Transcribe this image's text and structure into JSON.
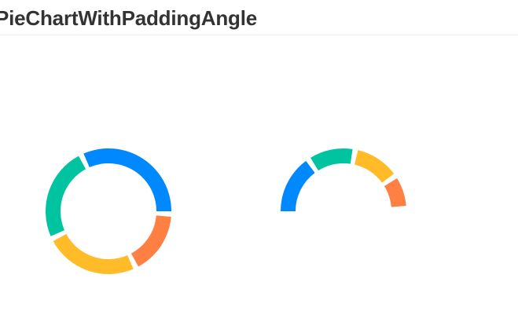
{
  "page": {
    "title": "PieChartWithPaddingAngle"
  },
  "chart_data": [
    {
      "type": "pie",
      "variant": "donut",
      "title": "",
      "start_angle": 0,
      "end_angle": 360,
      "padding_angle_deg": 5,
      "legend": "none",
      "slices": [
        {
          "value": 400,
          "color": "#0088FE"
        },
        {
          "value": 300,
          "color": "#00C49F"
        },
        {
          "value": 300,
          "color": "#FFBB28"
        },
        {
          "value": 200,
          "color": "#FF8042"
        }
      ]
    },
    {
      "type": "pie",
      "variant": "half-donut",
      "title": "",
      "start_angle": 180,
      "end_angle": 0,
      "padding_angle_deg": 5,
      "legend": "none",
      "slices": [
        {
          "value": 400,
          "color": "#0088FE"
        },
        {
          "value": 300,
          "color": "#00C49F"
        },
        {
          "value": 300,
          "color": "#FFBB28"
        },
        {
          "value": 200,
          "color": "#FF8042"
        }
      ]
    }
  ]
}
